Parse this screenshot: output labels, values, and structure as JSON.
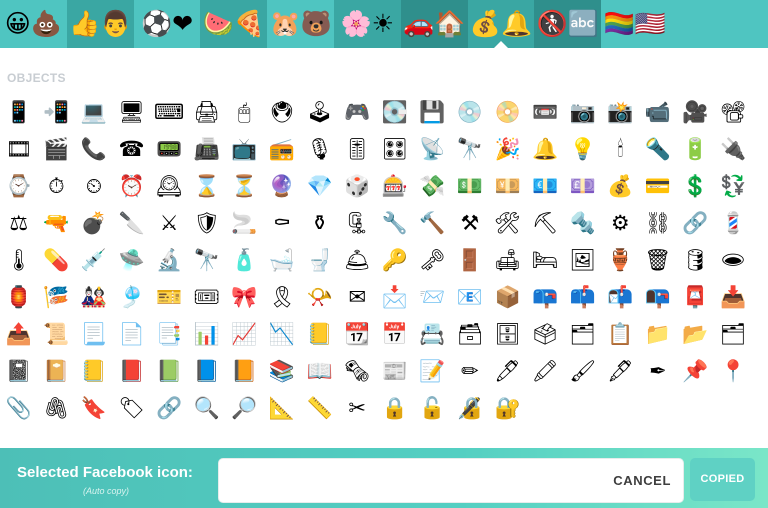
{
  "tabs": [
    {
      "name": "smileys",
      "glyph": "😀💩",
      "color": "c0"
    },
    {
      "name": "people",
      "glyph": "👍👨",
      "color": "c1"
    },
    {
      "name": "activity",
      "glyph": "⚽❤",
      "color": "c0"
    },
    {
      "name": "food",
      "glyph": "🍉🍕",
      "color": "c1"
    },
    {
      "name": "animals",
      "glyph": "🐹🐻",
      "color": "c0"
    },
    {
      "name": "nature",
      "glyph": "🌸☀",
      "color": "c1"
    },
    {
      "name": "travel",
      "glyph": "🚗🏠",
      "color": "c2"
    },
    {
      "name": "objects",
      "glyph": "💰🔔",
      "color": "c1",
      "active": true
    },
    {
      "name": "symbols",
      "glyph": "🚷🔤",
      "color": "c2"
    },
    {
      "name": "flags",
      "glyph": "🏳‍🌈🇺🇸",
      "color": "c0"
    }
  ],
  "section_title": "OBJECTS",
  "grid_rows": [
    [
      "📱",
      "📲",
      "💻",
      "🖥",
      "⌨",
      "🖨",
      "🖱",
      "🖲",
      "🕹",
      "🎮",
      "💽",
      "💾",
      "💿",
      "📀",
      "📼",
      "📷",
      "📸",
      "📹",
      "🎥",
      "📽"
    ],
    [
      "🎞",
      "🎬",
      "📞",
      "☎",
      "📟",
      "📠",
      "📺",
      "📻",
      "🎙",
      "🎚",
      "🎛",
      "📡",
      "🔭",
      "🎉",
      "🔔",
      "💡",
      "🕯",
      "🔦",
      "🔋",
      "🔌"
    ],
    [
      "⌚",
      "⏱",
      "⏲",
      "⏰",
      "🕰",
      "⌛",
      "⏳",
      "🔮",
      "💎",
      "🎲",
      "🎰",
      "💸",
      "💵",
      "💴",
      "💶",
      "💷",
      "💰",
      "💳",
      "💲",
      "💱"
    ],
    [
      "⚖",
      "🔫",
      "💣",
      "🔪",
      "⚔",
      "🛡",
      "🚬",
      "⚰",
      "⚱",
      "🗜",
      "🔧",
      "🔨",
      "⚒",
      "🛠",
      "⛏",
      "🔩",
      "⚙",
      "⛓",
      "🔗",
      "💈"
    ],
    [
      "🌡",
      "💊",
      "💉",
      "🛸",
      "🔬",
      "🔭",
      "🧴",
      "🛁",
      "🚽",
      "🛎",
      "🔑",
      "🗝",
      "🚪",
      "🛋",
      "🛏",
      "🖼",
      "🏺",
      "🗑",
      "🛢",
      "🕳"
    ],
    [
      "🏮",
      "🎏",
      "🎎",
      "🎐",
      "🎫",
      "🎟",
      "🎀",
      "🎗",
      "📯",
      "✉",
      "📩",
      "📨",
      "📧",
      "📦",
      "📪",
      "📫",
      "📬",
      "📭",
      "📮",
      "📥"
    ],
    [
      "📤",
      "📜",
      "📃",
      "📄",
      "📑",
      "📊",
      "📈",
      "📉",
      "📒",
      "📆",
      "📅",
      "📇",
      "🗃",
      "🗄",
      "🗳",
      "🗂",
      "📋",
      "📁",
      "📂",
      "🗂"
    ],
    [
      "📓",
      "📔",
      "📒",
      "📕",
      "📗",
      "📘",
      "📙",
      "📚",
      "📖",
      "🗞",
      "📰",
      "📝",
      "✏",
      "🖊",
      "🖍",
      "🖌",
      "🖋",
      "✒",
      "📌",
      "📍"
    ],
    [
      "📎",
      "🖇",
      "🔖",
      "🏷",
      "🔗",
      "🔍",
      "🔎",
      "📐",
      "📏",
      "✂",
      "🔒",
      "🔓",
      "🔏",
      "🔐"
    ]
  ],
  "bottom": {
    "label": "Selected Facebook icon:",
    "sublabel": "(Auto copy)",
    "input_value": "",
    "cancel_label": "CANCEL",
    "copied_label": "COPIED"
  }
}
